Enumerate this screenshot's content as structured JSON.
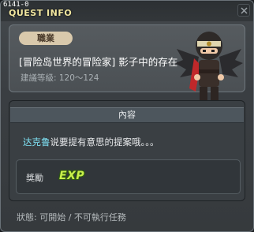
{
  "window": {
    "quest_id": "6141-0",
    "title": "QUEST INFO"
  },
  "header": {
    "job_label": "職業",
    "quest_name": "[冒险岛世界的冒险家] 影子中的存在",
    "level_text": "建議等級: 120～124"
  },
  "content": {
    "section_title": "內容",
    "npc_name": "达克鲁",
    "description": "说要提有意思的提案哦。。。"
  },
  "reward": {
    "label": "獎勵",
    "exp_text": "EXP"
  },
  "status": {
    "text": "狀態: 可開始 / 不可執行任務"
  },
  "colors": {
    "title": "#f2e7a0",
    "npc_name": "#7fe3f5",
    "badge": "#d9c9ac",
    "exp": "#c8f04a"
  }
}
